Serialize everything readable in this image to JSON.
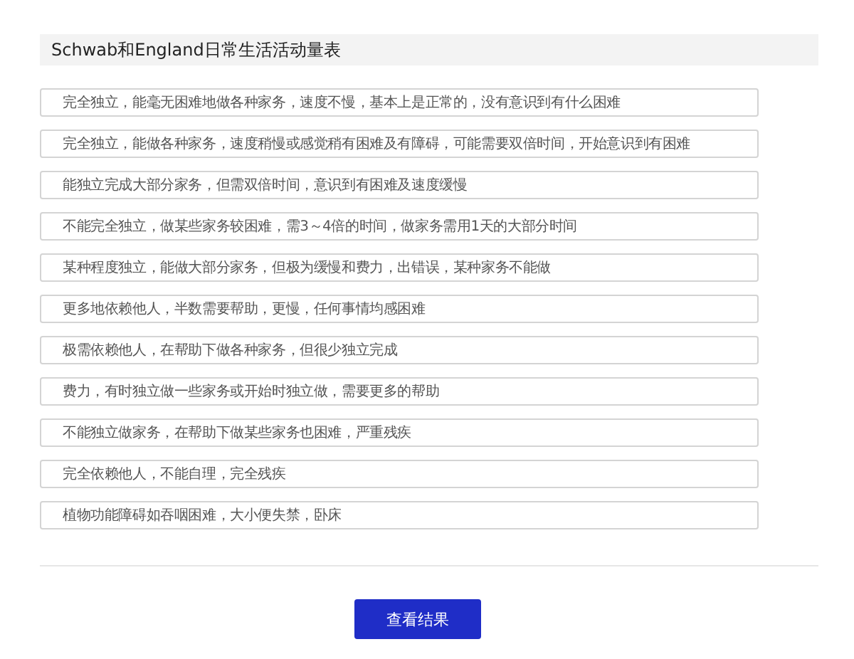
{
  "title": "Schwab和England日常生活活动量表",
  "options": [
    {
      "label": "完全独立，能毫无困难地做各种家务，速度不慢，基本上是正常的，没有意识到有什么困难",
      "selected": false
    },
    {
      "label": "完全独立，能做各种家务，速度稍慢或感觉稍有困难及有障碍，可能需要双倍时间，开始意识到有困难",
      "selected": false
    },
    {
      "label": "能独立完成大部分家务，但需双倍时间，意识到有困难及速度缓慢",
      "selected": false
    },
    {
      "label": "不能完全独立，做某些家务较困难，需3～4倍的时间，做家务需用1天的大部分时间",
      "selected": false
    },
    {
      "label": "某种程度独立，能做大部分家务，但极为缓慢和费力，出错误，某种家务不能做",
      "selected": false
    },
    {
      "label": "更多地依赖他人，半数需要帮助，更慢，任何事情均感困难",
      "selected": false
    },
    {
      "label": "极需依赖他人，在帮助下做各种家务，但很少独立完成",
      "selected": false
    },
    {
      "label": "费力，有时独立做一些家务或开始时独立做，需要更多的帮助",
      "selected": false
    },
    {
      "label": "不能独立做家务，在帮助下做某些家务也困难，严重残疾",
      "selected": false
    },
    {
      "label": "完全依赖他人，不能自理，完全残疾",
      "selected": false
    },
    {
      "label": "植物功能障碍如吞咽困难，大小便失禁，卧床",
      "selected": false
    }
  ],
  "button": "查看结果"
}
